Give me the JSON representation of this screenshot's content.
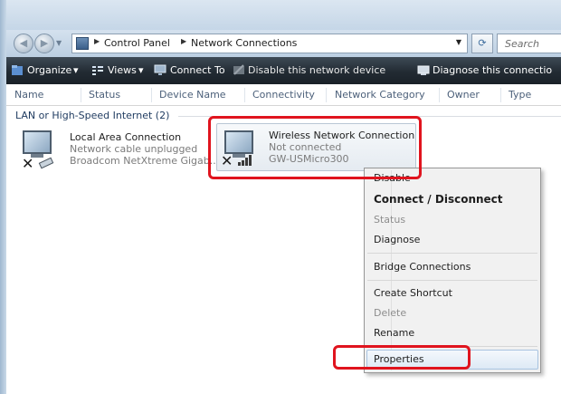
{
  "address": {
    "crumbs": [
      "Control Panel",
      "Network Connections"
    ],
    "search_placeholder": "Search"
  },
  "toolbar": {
    "organize": "Organize",
    "views": "Views",
    "connect_to": "Connect To",
    "disable": "Disable this network device",
    "diagnose": "Diagnose this connectio"
  },
  "columns": [
    "Name",
    "Status",
    "Device Name",
    "Connectivity",
    "Network Category",
    "Owner",
    "Type"
  ],
  "group_label": "LAN or High-Speed Internet (2)",
  "connections": [
    {
      "name": "Local Area Connection",
      "status": "Network cable unplugged",
      "device": "Broadcom NetXtreme Gigab..."
    },
    {
      "name": "Wireless Network Connection",
      "status": "Not connected",
      "device": "GW-USMicro300"
    }
  ],
  "context_menu": {
    "disable": "Disable",
    "connect": "Connect / Disconnect",
    "status": "Status",
    "diagnose": "Diagnose",
    "bridge": "Bridge Connections",
    "shortcut": "Create Shortcut",
    "delete": "Delete",
    "rename": "Rename",
    "properties": "Properties"
  },
  "colors": {
    "highlight_red": "#e0141e",
    "toolbar_dark": "#222b33"
  }
}
